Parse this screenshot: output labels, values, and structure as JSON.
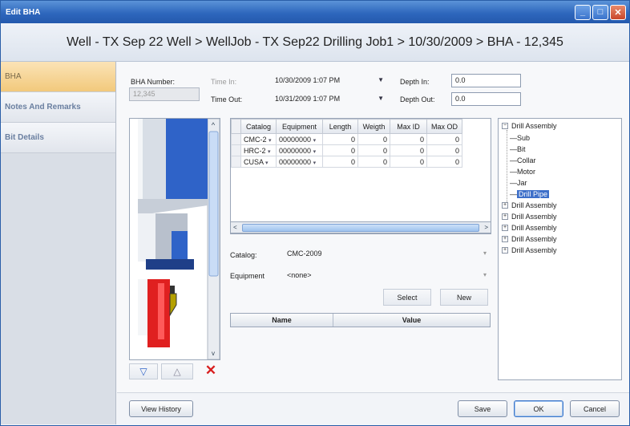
{
  "window": {
    "title": "Edit BHA",
    "breadcrumb": "Well - TX Sep 22 Well > WellJob - TX Sep22 Drilling Job1 > 10/30/2009 > BHA - 12,345"
  },
  "nav": {
    "items": [
      {
        "label": "BHA"
      },
      {
        "label": "Notes And Remarks"
      },
      {
        "label": "Bit Details"
      }
    ]
  },
  "form": {
    "bha_number_label": "BHA Number:",
    "bha_number_value": "12,345",
    "time_in_label": "Time In:",
    "time_in_value": "10/30/2009 1:07 PM",
    "time_out_label": "Time Out:",
    "time_out_value": "10/31/2009 1:07 PM",
    "depth_in_label": "Depth In:",
    "depth_in_value": "0.0",
    "depth_out_label": "Depth Out:",
    "depth_out_value": "0.0"
  },
  "grid": {
    "columns": [
      "Catalog",
      "Equipment",
      "Length",
      "Weigth",
      "Max ID",
      "Max OD"
    ],
    "rows": [
      {
        "catalog": "CMC-2",
        "equipment": "00000000",
        "length": "0",
        "weight": "0",
        "max_id": "0",
        "max_od": "0"
      },
      {
        "catalog": "HRC-2",
        "equipment": "00000000",
        "length": "0",
        "weight": "0",
        "max_id": "0",
        "max_od": "0"
      },
      {
        "catalog": "CUSA",
        "equipment": "00000000",
        "length": "0",
        "weight": "0",
        "max_id": "0",
        "max_od": "0"
      }
    ]
  },
  "selector": {
    "catalog_label": "Catalog:",
    "catalog_value": "CMC-2009",
    "equipment_label": "Equipment",
    "equipment_value": "<none>",
    "select_label": "Select",
    "new_label": "New",
    "name_header": "Name",
    "value_header": "Value"
  },
  "tree": {
    "root": "Drill Assembly",
    "children": [
      "Sub",
      "Bit",
      "Collar",
      "Motor",
      "Jar",
      "Drill Pipe"
    ],
    "selected": "Drill Pipe",
    "collapsed": [
      "Drill Assembly",
      "Drill Assembly",
      "Drill Assembly",
      "Drill Assembly",
      "Drill Assembly"
    ]
  },
  "footer": {
    "view_history": "View History",
    "save": "Save",
    "ok": "OK",
    "cancel": "Cancel"
  },
  "colors": {
    "titlebar": "#2e67bd",
    "active_tab": "#f2c97c",
    "pipe_blue": "#2f63c8",
    "red_component": "#e02020",
    "delete_red": "#d81e1e"
  }
}
